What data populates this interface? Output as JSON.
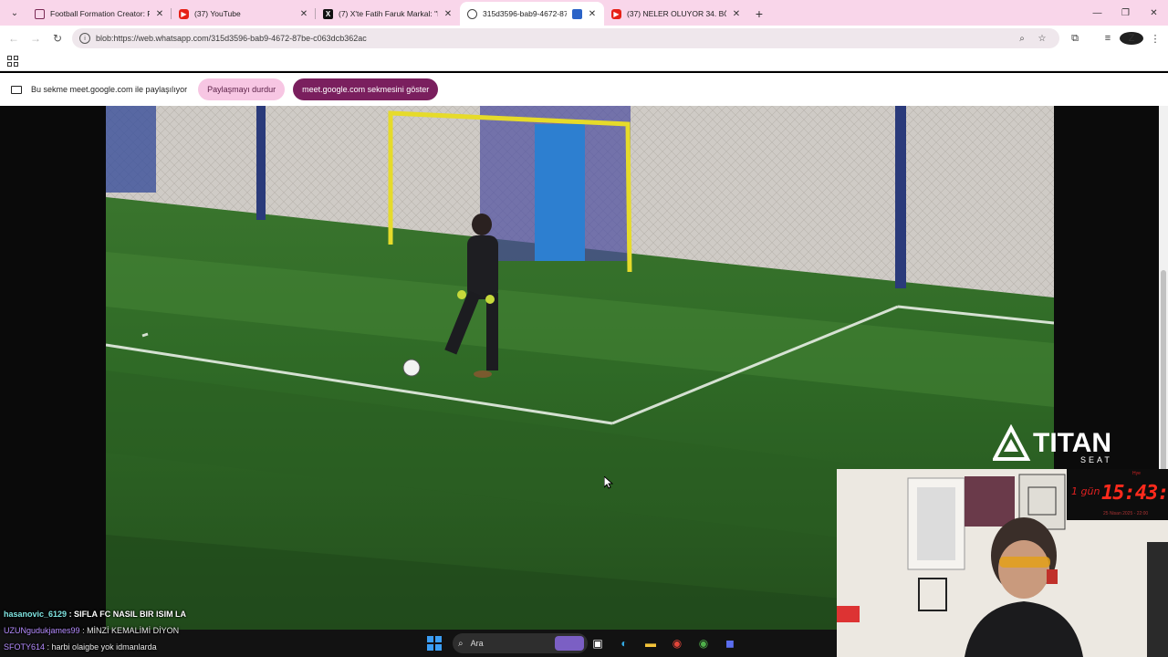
{
  "browser": {
    "tabs": [
      {
        "title": "Football Formation Creator: Re",
        "favicon": "document-icon",
        "active": false
      },
      {
        "title": "(37) YouTube",
        "favicon": "youtube-icon",
        "active": false
      },
      {
        "title": "(7) X'te Fatih Faruk Markal: \"Lis",
        "favicon": "x-icon",
        "active": false
      },
      {
        "title": "315d3596-bab9-4672-87be-",
        "favicon": "globe-icon",
        "active": true
      },
      {
        "title": "(37) NELER OLUYOR 34. BÖLÜM",
        "favicon": "youtube-icon",
        "active": false
      }
    ],
    "new_tab_label": "+",
    "url": "blob:https://web.whatsapp.com/315d3596-bab9-4672-87be-c063dcb362ac"
  },
  "share_bar": {
    "message": "Bu sekme meet.google.com ile paylaşılıyor",
    "stop_button": "Paylaşmayı durdur",
    "show_button": "meet.google.com sekmesini göster"
  },
  "overlay": {
    "brand_logo": "TITAN",
    "brand_sub": "SEAT",
    "timer": {
      "day": "1 gün",
      "clock": "15:43:2",
      "label": "Hye",
      "date": "25 Nisan 2025 - 22:00"
    }
  },
  "chat": [
    {
      "user": "hasanovic_6129",
      "text": ": SIFLA FC NASIL BIR ISIM LA"
    },
    {
      "user": "UZUNgudukjames99",
      "text": ": MİNZİ KEMALİMİ DİYON"
    },
    {
      "user": "SFOTY614",
      "text": ": harbi olaigbe yok idmanlarda"
    }
  ],
  "taskbar": {
    "search_placeholder": "Ara"
  },
  "colors": {
    "tab_strip": "#f9d6ea",
    "stop_button_bg": "#f7c6e3",
    "show_button_bg": "#7a1f5e",
    "timer_red": "#ff2a1c"
  }
}
